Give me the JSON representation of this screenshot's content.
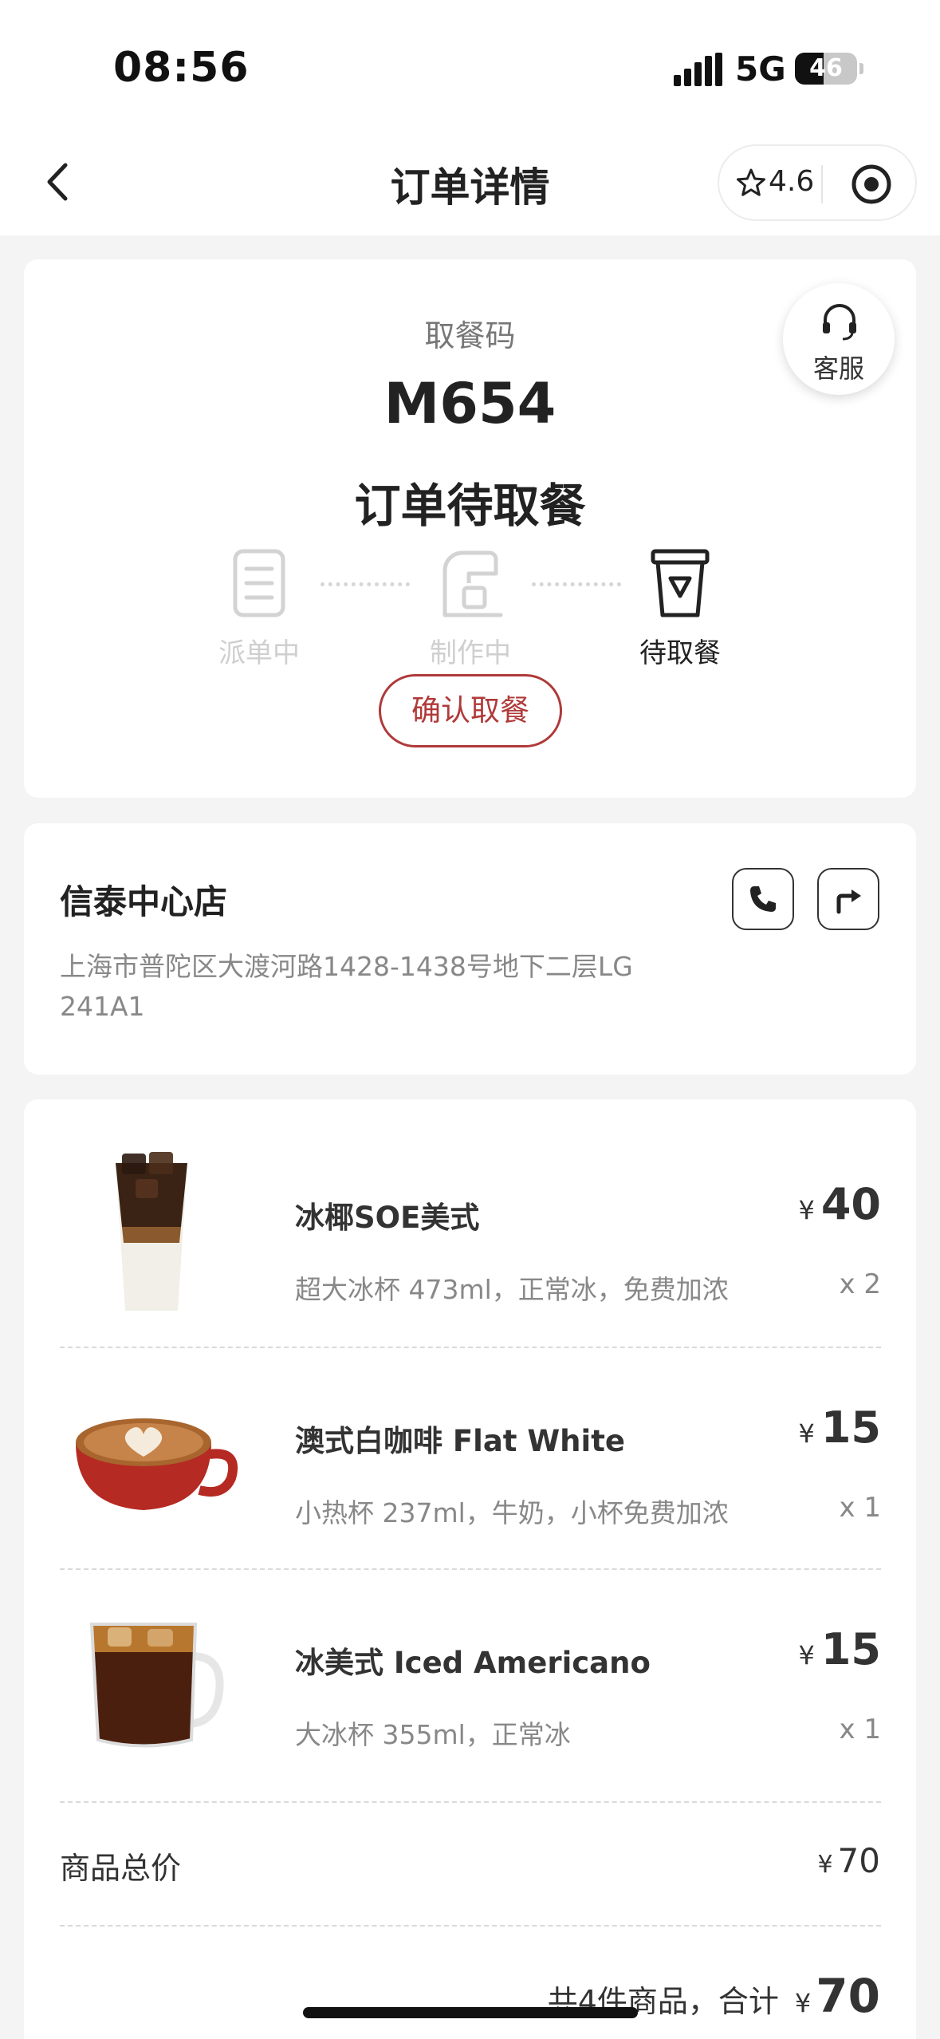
{
  "status_bar": {
    "time": "08:56",
    "network": "5G",
    "battery": "46",
    "battery_level_percent": 46
  },
  "nav": {
    "title": "订单详情",
    "rating": "4.6"
  },
  "order": {
    "pickup_label": "取餐码",
    "pickup_code": "M654",
    "state": "订单待取餐",
    "service_label": "客服",
    "steps": [
      {
        "label": "派单中",
        "active": false
      },
      {
        "label": "制作中",
        "active": false
      },
      {
        "label": "待取餐",
        "active": true
      }
    ],
    "confirm_label": "确认取餐"
  },
  "store": {
    "name": "信泰中心店",
    "address": "上海市普陀区大渡河路1428-1438号地下二层LG 241A1"
  },
  "items": [
    {
      "name": "冰椰SOE美式",
      "options": "超大冰杯 473ml，正常冰，免费加浓",
      "currency": "¥",
      "price": "40",
      "qty": "x 2",
      "image": "iced-coconut-americano"
    },
    {
      "name": "澳式白咖啡 Flat White",
      "options": "小热杯 237ml，牛奶，小杯免费加浓",
      "currency": "¥",
      "price": "15",
      "qty": "x 1",
      "image": "flat-white-cup"
    },
    {
      "name": "冰美式 Iced Americano",
      "options": "大冰杯 355ml，正常冰",
      "currency": "¥",
      "price": "15",
      "qty": "x 1",
      "image": "iced-americano-glass"
    }
  ],
  "summary": {
    "subtotal_label": "商品总价",
    "subtotal_currency": "¥",
    "subtotal_value": "70",
    "total_text": "共4件商品，合计",
    "total_currency": "¥",
    "total_value": "70"
  },
  "colors": {
    "accent": "#b03a3a",
    "background": "#f4f4f4",
    "card": "#ffffff",
    "inactive": "#cfcfcf"
  }
}
